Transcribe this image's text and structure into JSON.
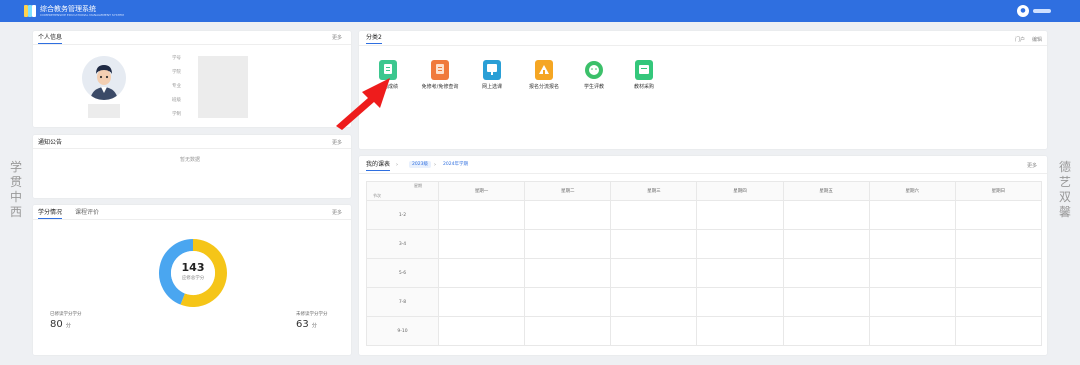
{
  "app": {
    "title": "综合教务管理系统",
    "subtitle": "COMPREHENSIVE EDUCATIONAL MANAGEMENT SYSTEM",
    "brand_color": "#2f6fe0",
    "user_icon": "user-icon"
  },
  "side": {
    "left": "学贯中西",
    "right": "德艺双馨"
  },
  "personal": {
    "title": "个人信息",
    "more": "更多",
    "avatar_icon": "student-avatar-icon",
    "fields": [
      "学号",
      "学院",
      "专业",
      "班级",
      "学制"
    ]
  },
  "notice": {
    "title": "通知公告",
    "more": "更多",
    "empty": "暂无数据"
  },
  "credits": {
    "tabs": [
      "学分情况",
      "课程评价"
    ],
    "more": "更多",
    "total": "143",
    "total_label": "应修总学分",
    "earned_label": "已修读学分学分",
    "earned_value": "80",
    "remaining_label": "未修读学分学分",
    "remaining_value": "63",
    "unit": "分",
    "colors": {
      "earned": "#f5c518",
      "remaining": "#4aa6f0"
    },
    "chart_data": {
      "type": "pie",
      "categories": [
        "已修读学分学分",
        "未修读学分学分"
      ],
      "values": [
        80,
        63
      ],
      "title": ""
    }
  },
  "apps": {
    "title": "分类2",
    "actions": [
      "门户",
      "编辑"
    ],
    "items": [
      {
        "label": "我的成绩",
        "icon": "grades-icon",
        "color": "#3cc78f"
      },
      {
        "label": "免修考/免修查询",
        "icon": "exemption-icon",
        "color": "#f07a3c"
      },
      {
        "label": "网上选课",
        "icon": "course-select-icon",
        "color": "#2a9fd6"
      },
      {
        "label": "报名分流报名",
        "icon": "enroll-icon",
        "color": "#f5a623"
      },
      {
        "label": "学生评教",
        "icon": "evaluation-icon",
        "color": "#3cc06a"
      },
      {
        "label": "教材采购",
        "icon": "textbook-icon",
        "color": "#34c77b"
      }
    ]
  },
  "timetable": {
    "title": "我的课表",
    "filters": [
      "2023级",
      "2024年学期"
    ],
    "more": "更多",
    "corner_top": "星期",
    "corner_bottom": "节次",
    "days": [
      "星期一",
      "星期二",
      "星期三",
      "星期四",
      "星期五",
      "星期六",
      "星期日"
    ],
    "sections": [
      "1-2",
      "3-4",
      "5-6",
      "7-8",
      "9-10"
    ]
  }
}
